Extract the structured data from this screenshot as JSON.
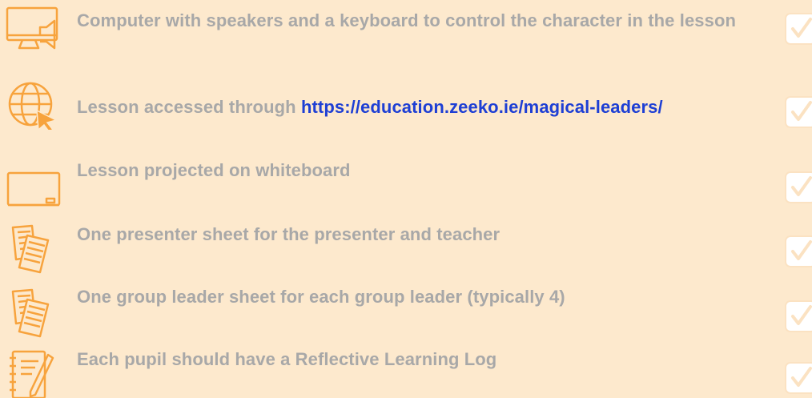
{
  "colors": {
    "background": "#fde9cd",
    "text": "#a8a8a8",
    "link": "#1e3fd4",
    "icon": "#f7a33d",
    "check": "#fbe2c2"
  },
  "items": [
    {
      "icon": "computer-speaker-icon",
      "text": "Computer with speakers and a keyboard to control the character in the lesson"
    },
    {
      "icon": "globe-cursor-icon",
      "text_prefix": "Lesson accessed through ",
      "link": "https://education.zeeko.ie/magical-leaders/"
    },
    {
      "icon": "whiteboard-icon",
      "text": "Lesson projected on whiteboard"
    },
    {
      "icon": "documents-icon",
      "text": "One presenter sheet for the presenter and teacher"
    },
    {
      "icon": "documents-icon",
      "text": "One group leader sheet for each group leader (typically 4)"
    },
    {
      "icon": "notebook-pen-icon",
      "text": "Each pupil should have a Reflective Learning Log"
    }
  ]
}
